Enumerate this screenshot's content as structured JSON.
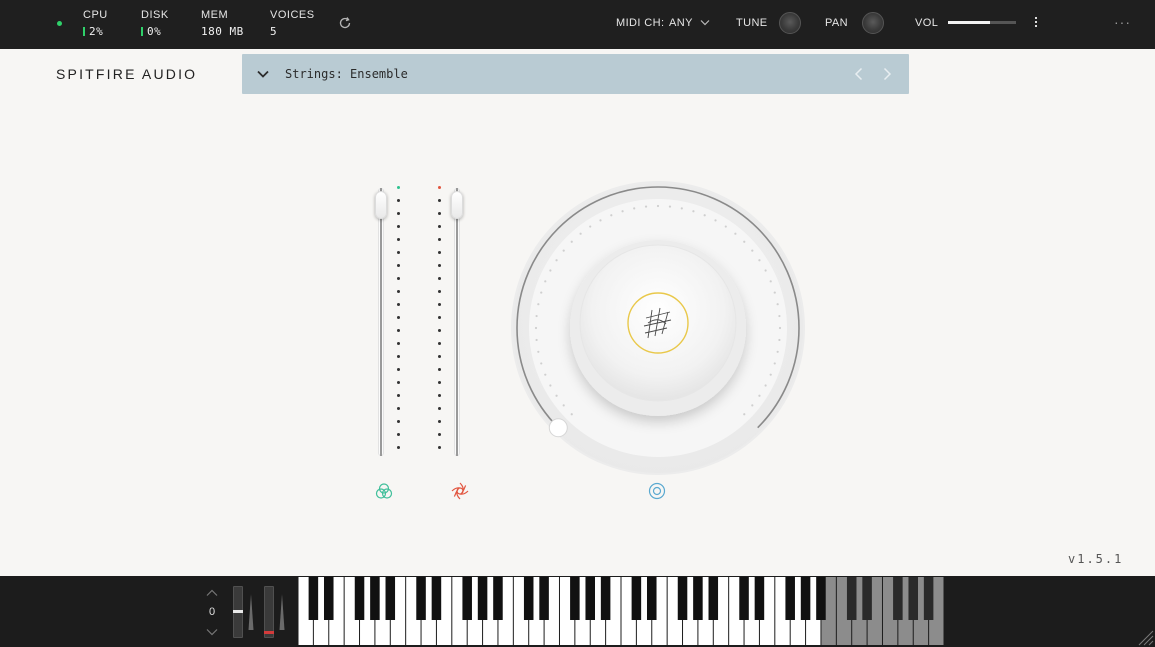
{
  "topbar": {
    "stats": [
      {
        "label": "CPU",
        "value": "2%",
        "bar": true
      },
      {
        "label": "DISK",
        "value": "0%",
        "bar": true
      },
      {
        "label": "MEM",
        "value": "180 MB",
        "bar": false
      },
      {
        "label": "VOICES",
        "value": "5",
        "bar": false
      }
    ],
    "midi_label": "MIDI CH:",
    "midi_value": "ANY",
    "tune_label": "TUNE",
    "pan_label": "PAN",
    "vol_label": "VOL",
    "vol_level": 0.62,
    "more": "···"
  },
  "brand": "SPITFIRE AUDIO",
  "preset": {
    "name": "Strings: Ensemble"
  },
  "sliders": {
    "left_level": 0.97,
    "right_level": 0.97,
    "left_accent": "#2fc28f",
    "right_accent": "#e2553f"
  },
  "dial": {
    "level": 0.0,
    "ring_accent": "#e9c84a",
    "center_accent": "#5aa9d0"
  },
  "version": "v1.5.1",
  "keyboard": {
    "octave": "0",
    "white_keys": 42,
    "inactive_from": 34
  },
  "colors": {
    "accent_green": "#2fd06a",
    "preset_bg": "#b9cbd3"
  }
}
